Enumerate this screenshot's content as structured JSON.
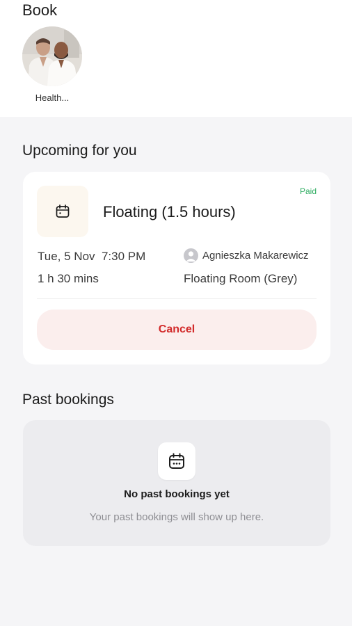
{
  "book": {
    "title": "Book",
    "items": [
      {
        "label": "Health...",
        "image": "portrait-photo-two-men-in-robes"
      }
    ]
  },
  "upcoming": {
    "title": "Upcoming for you",
    "booking": {
      "icon": "calendar-icon",
      "status": "Paid",
      "service": "Floating (1.5 hours)",
      "date_time": "Tue, 5 Nov  7:30 PM",
      "duration": "1 h 30 mins",
      "staff": "Agnieszka Makarewicz",
      "room": "Floating Room (Grey)",
      "cancel_label": "Cancel"
    }
  },
  "past": {
    "title": "Past bookings",
    "empty_icon": "calendar-icon",
    "empty_title": "No past bookings yet",
    "empty_subtitle": "Your past bookings will show up here."
  },
  "colors": {
    "paid": "#2bab5f",
    "cancel_text": "#d22a2a",
    "cancel_bg": "#fbeeed"
  }
}
